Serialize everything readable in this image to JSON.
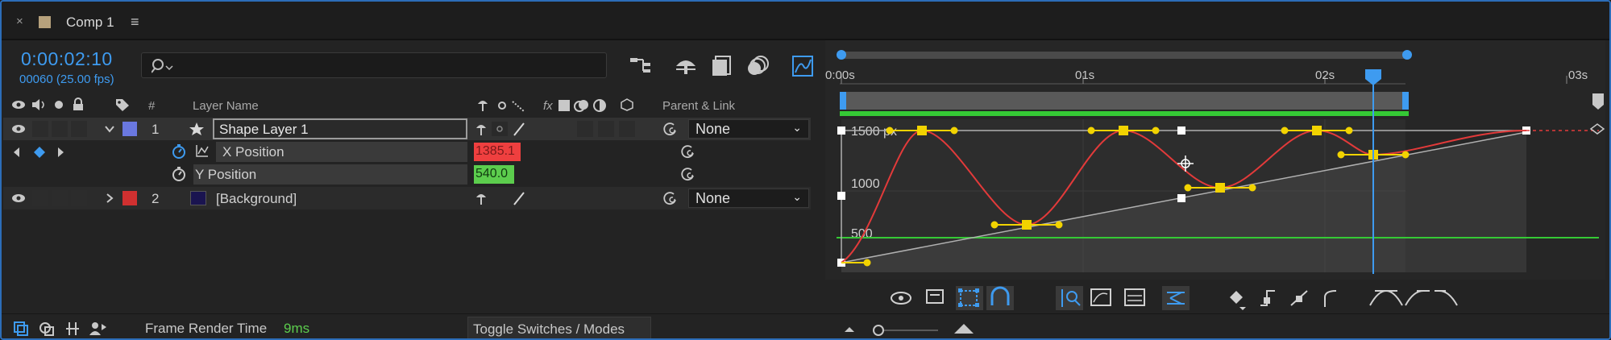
{
  "tab": {
    "title": "Comp 1",
    "close_icon": "×",
    "menu_icon": "≡"
  },
  "time": {
    "current": "0:00:02:10",
    "frames": "00060 (25.00 fps)"
  },
  "search": {
    "placeholder": ""
  },
  "columns": {
    "layer_name": "Layer Name",
    "number": "#",
    "parent_link": "Parent & Link",
    "fx": "fx"
  },
  "layers": [
    {
      "index": "1",
      "name": "Shape Layer 1",
      "label_color": "#6a78e0",
      "parent": "None"
    },
    {
      "index": "2",
      "name": "[Background]",
      "label_color": "#d03030",
      "parent": "None"
    }
  ],
  "properties": [
    {
      "name": "X Position",
      "value": "1385.1",
      "value_color": "#ef3f3f"
    },
    {
      "name": "Y Position",
      "value": "540.0",
      "value_color": "#5ccd4d"
    }
  ],
  "ruler": {
    "labels": [
      "0:00s",
      "01s",
      "02s",
      "03s"
    ]
  },
  "graph": {
    "y_labels": [
      "1500 px",
      "1000",
      "500"
    ]
  },
  "bottom": {
    "render_label": "Frame Render Time",
    "render_value": "9ms",
    "toggle": "Toggle Switches / Modes"
  },
  "colors": {
    "accent": "#3e9bf0",
    "keyframe": "#f2d300",
    "curve": "#e23a3a",
    "green": "#35c935"
  }
}
